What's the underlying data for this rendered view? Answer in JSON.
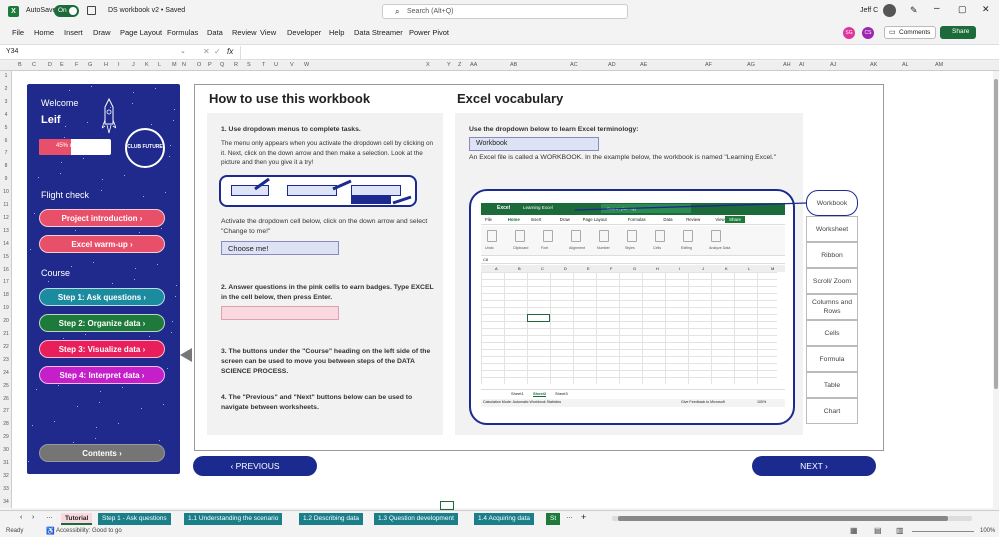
{
  "titlebar": {
    "app_icon": "excel-icon",
    "autosave_label": "AutoSave",
    "autosave_state": "On",
    "save_icon": "save-icon",
    "doc_title": "DS workbook v2 • Saved",
    "search_placeholder": "Search (Alt+Q)",
    "user_name": "Jeff C",
    "pen_icon": "pen-icon",
    "minimize_icon": "minimize-icon",
    "restore_icon": "restore-icon",
    "close_icon": "close-icon"
  },
  "menu": [
    "File",
    "Home",
    "Insert",
    "Draw",
    "Page Layout",
    "Formulas",
    "Data",
    "Review",
    "View",
    "Developer",
    "Help",
    "Data Streamer",
    "Power Pivot"
  ],
  "menu_right": {
    "avatar1": "SG",
    "avatar2": "CS",
    "comments_label": "Comments",
    "share_label": "Share"
  },
  "formula_bar": {
    "name_box": "Y34",
    "fx": "fx",
    "value": ""
  },
  "columns": [
    "B",
    "C",
    "D",
    "E",
    "F",
    "G",
    "H",
    "I",
    "J",
    "K",
    "L",
    "M",
    "N",
    "O",
    "P",
    "Q",
    "R",
    "S",
    "T",
    "U",
    "V",
    "W",
    "X",
    "Y",
    "Z",
    "AA",
    "AB",
    "AC",
    "AD",
    "AE",
    "AF",
    "AG",
    "AH",
    "AI",
    "AJ",
    "AK",
    "AL",
    "AM"
  ],
  "rows": [
    "1",
    "2",
    "3",
    "4",
    "5",
    "6",
    "7",
    "8",
    "9",
    "10",
    "11",
    "12",
    "13",
    "14",
    "15",
    "16",
    "17",
    "18",
    "19",
    "20",
    "21",
    "22",
    "23",
    "24",
    "25",
    "26",
    "27",
    "28",
    "29",
    "30",
    "31",
    "32",
    "33",
    "34"
  ],
  "left_panel": {
    "welcome": "Welcome",
    "name": "Leif",
    "progress_text": "45% complete",
    "progress": 0.45,
    "badge": "CLUB FUTURE",
    "flight_check": "Flight check",
    "course": "Course",
    "buttons": [
      {
        "label": "Project introduction ›",
        "color": "#e8506a"
      },
      {
        "label": "Excel warm-up ›",
        "color": "#e8506a"
      },
      {
        "label": "Step 1: Ask questions ›",
        "color": "#1b8ba0"
      },
      {
        "label": "Step 2: Organize data ›",
        "color": "#1d7a3a"
      },
      {
        "label": "Step 3: Visualize data ›",
        "color": "#e81f5a"
      },
      {
        "label": "Step 4: Interpret data ›",
        "color": "#c41fc9"
      }
    ],
    "contents": "Contents ›"
  },
  "how_to": {
    "title": "How to use this workbook",
    "step1_title": "1. Use dropdown menus to complete tasks.",
    "step1_body": "The menu only appears when you activate the dropdown cell by clicking on it. Next, click on the down arrow and then make a selection. Look at the picture and then you give it a try!",
    "activate_text": "Activate the dropdown cell below, click on the down arrow and select \"Change to me!\"",
    "dropdown_value": "Choose me!",
    "step2": "2. Answer questions in the pink cells to earn badges. Type EXCEL in the cell below, then press Enter.",
    "step3": "3. The buttons under the \"Course\" heading on the left side of the screen can be used to move you between steps of the DATA SCIENCE PROCESS.",
    "step4": "4. The \"Previous\" and \"Next\" buttons below can be used to navigate between worksheets."
  },
  "vocab": {
    "title": "Excel vocabulary",
    "instruction": "Use the dropdown below to learn Excel terminology:",
    "selected": "Workbook",
    "definition": "An Excel file is called a WORKBOOK. In the example below, the workbook is named \"Learning Excel.\"",
    "terms": [
      "Workbook",
      "Worksheet",
      "Ribbon",
      "Scroll/ Zoom",
      "Columns and Rows",
      "Cells",
      "Formula",
      "Table",
      "Chart"
    ]
  },
  "mini_excel": {
    "app": "Excel",
    "doc": "Learning Excel",
    "search": "Search (Alt + Q)",
    "share": "Share",
    "menu": [
      "File",
      "Home",
      "Insert",
      "Draw",
      "Page Layout",
      "Formulas",
      "Data",
      "Review",
      "View"
    ],
    "groups": [
      "Undo",
      "Clipboard",
      "Font",
      "Alignment",
      "Number",
      "Styles",
      "Cells",
      "Editing",
      "Analyze Data"
    ],
    "name_box": "C8",
    "cols": [
      "A",
      "B",
      "C",
      "D",
      "E",
      "F",
      "G",
      "H",
      "I",
      "J",
      "K",
      "L",
      "M"
    ],
    "sheets": [
      "Sheet1",
      "Sheet2",
      "Sheet3"
    ],
    "status_left": "Calculation Mode: Automatic    Workbook Statistics",
    "status_right": "Give Feedback to Microsoft",
    "zoom": "100%"
  },
  "nav": {
    "previous": "‹ PREVIOUS",
    "next": "NEXT ›"
  },
  "tabs": [
    "Tutorial",
    "Step 1 - Ask questions",
    "1.1 Understanding the scenario",
    "1.2 Describing data",
    "1.3 Question development",
    "1.4 Acquiring data",
    "St"
  ],
  "status": {
    "ready": "Ready",
    "accessibility": "Accessibility: Good to go",
    "zoom": "100%"
  }
}
